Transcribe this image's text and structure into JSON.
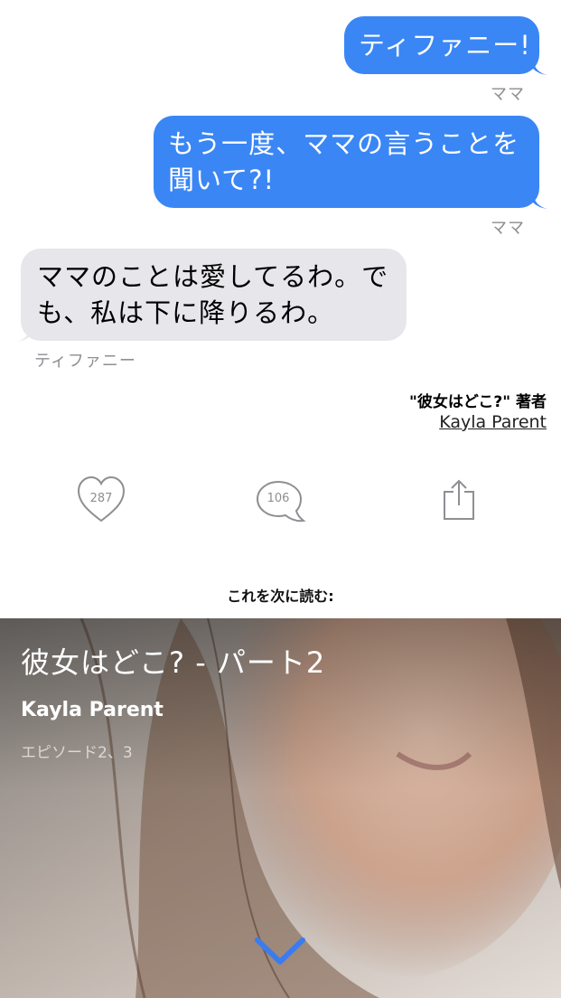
{
  "messages": [
    {
      "text": "ティファニー!",
      "sender": "ママ",
      "direction": "outgoing"
    },
    {
      "text_line1": "もう一度、ママの言うことを",
      "text_line2": "聞いて?!",
      "sender": "ママ",
      "direction": "outgoing"
    },
    {
      "text_line1": "ママのことは愛してるわ。で",
      "text_line2": "も、私は下に降りるわ。",
      "sender": "ティファニー",
      "direction": "incoming"
    }
  ],
  "credit": {
    "title": "\"彼女はどこ?\" 著者",
    "author": "Kayla Parent"
  },
  "actions": {
    "likes": "287",
    "comments": "106",
    "share_icon": "share-icon"
  },
  "read_next": {
    "heading": "これを次に読む:",
    "title": "彼女はどこ? - パート2",
    "author": "Kayla Parent",
    "episodes": "エピソード2、3"
  },
  "colors": {
    "outgoing_bubble": "#3a86f5",
    "incoming_bubble": "#e6e6eb",
    "chevron": "#3a7cf0"
  }
}
